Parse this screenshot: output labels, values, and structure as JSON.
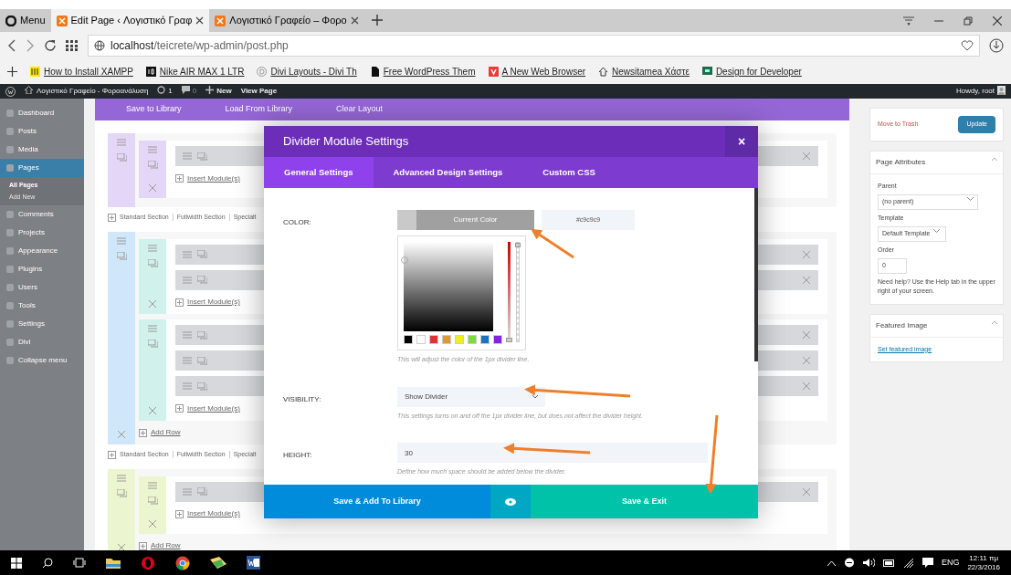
{
  "browser": {
    "menu_button": "Menu",
    "tabs": [
      {
        "label": "Edit Page ‹ Λογιστικό Γραφ",
        "selected": true
      },
      {
        "label": "Λογιστικό Γραφείο – Φορο",
        "selected": false
      }
    ],
    "address": {
      "host": "localhost",
      "path": "/teicrete/wp-admin/post.php"
    },
    "bookmarks": [
      {
        "label": "How to Install XAMPP",
        "kind": "xampp"
      },
      {
        "label": "Nike AIR MAX 1 LTR",
        "kind": "nike"
      },
      {
        "label": "Divi Layouts - Divi Th",
        "kind": "divi"
      },
      {
        "label": "Free WordPress Them",
        "kind": "page"
      },
      {
        "label": "A New Web Browser",
        "kind": "vivaldi"
      },
      {
        "label": "Newsitamea Χάστε",
        "kind": "house"
      },
      {
        "label": "Design for Developer",
        "kind": "screen"
      }
    ]
  },
  "admin_bar": {
    "site": "Λογιστικό Γραφείο - Φοροανάλυση",
    "updates": "1",
    "comments": "0",
    "new": "New",
    "view": "View Page",
    "greeting": "Howdy, root"
  },
  "admin_menu": [
    {
      "label": "Dashboard",
      "selected": false
    },
    {
      "label": "Posts",
      "selected": false
    },
    {
      "label": "Media",
      "selected": false
    },
    {
      "label": "Pages",
      "selected": true,
      "children": [
        {
          "label": "All Pages",
          "selected": true
        },
        {
          "label": "Add New",
          "selected": false
        }
      ]
    },
    {
      "label": "Comments",
      "selected": false
    },
    {
      "label": "Projects",
      "selected": false
    },
    {
      "label": "Appearance",
      "selected": false
    },
    {
      "label": "Plugins",
      "selected": false
    },
    {
      "label": "Users",
      "selected": false
    },
    {
      "label": "Tools",
      "selected": false
    },
    {
      "label": "Settings",
      "selected": false
    },
    {
      "label": "Divi",
      "selected": false
    },
    {
      "label": "Collapse menu",
      "selected": false
    }
  ],
  "builder": {
    "toolbar": [
      "Save to Library",
      "Load From Library",
      "Clear Layout"
    ],
    "sections": [
      {
        "color": "#e4d6f6",
        "rows": [
          {
            "color": "#e4d6f6",
            "insert": "Insert Module(s)"
          }
        ],
        "links": [
          "Standard Section",
          "Fullwidth Section",
          "Specialt"
        ]
      },
      {
        "color": "#cfe7f8",
        "rows": [
          {
            "color": "#d0f1ec",
            "insert": "Insert Module(s)"
          },
          {
            "color": "#d0f1ec",
            "insert": "Insert Module(s)"
          }
        ],
        "add_row": "Add Row",
        "links": [
          "Standard Section",
          "Fullwidth Section",
          "Specialt"
        ]
      },
      {
        "color": "#ebf5cf",
        "rows": [
          {
            "color": "#ebf5cf",
            "insert": "Insert Module(s)"
          }
        ],
        "add_row": "Add Row"
      }
    ]
  },
  "publish": {
    "trash": "Move to Trash",
    "update": "Update"
  },
  "page_attributes": {
    "title": "Page Attributes",
    "parent_label": "Parent",
    "parent": "(no parent)",
    "template_label": "Template",
    "template": "Default Template",
    "order_label": "Order",
    "order": "0",
    "help": "Need help? Use the Help tab in the upper right of your screen."
  },
  "featured_image": {
    "title": "Featured Image",
    "link": "Set featured image"
  },
  "modal": {
    "title": "Divider Module Settings",
    "close": "×",
    "tabs": [
      {
        "label": "General Settings",
        "selected": true
      },
      {
        "label": "Advanced Design Settings",
        "selected": false
      },
      {
        "label": "Custom CSS",
        "selected": false
      }
    ],
    "fields": [
      {
        "kind": "color",
        "label": "COLOR:",
        "button": "Current Color",
        "value": "#c9c9c9",
        "swatches": [
          {
            "color": "#000000"
          },
          {
            "color": "#ffffff"
          },
          {
            "color": "#dd3333"
          },
          {
            "color": "#dd9933"
          },
          {
            "color": "#eeee22"
          },
          {
            "color": "#81d742"
          },
          {
            "color": "#1e73be"
          },
          {
            "color": "#8224e3"
          }
        ],
        "hue_slider": {
          "level": 0
        },
        "opacity_slider": {
          "level": 1
        },
        "help": "This will adjust the color of the 1px divider line."
      },
      {
        "kind": "select",
        "label": "VISIBILITY:",
        "value": "Show Divider",
        "help": "This settings turns on and off the 1px divider line, but does not affect the divider height."
      },
      {
        "kind": "text",
        "label": "HEIGHT:",
        "value": "30",
        "help": "Define how much space should be added below the divider."
      }
    ],
    "footer": {
      "library": "Save & Add To Library",
      "exit": "Save & Exit"
    }
  },
  "taskbar": {
    "language": "ENG",
    "time": "12:11 πμ",
    "date": "22/3/2016"
  }
}
